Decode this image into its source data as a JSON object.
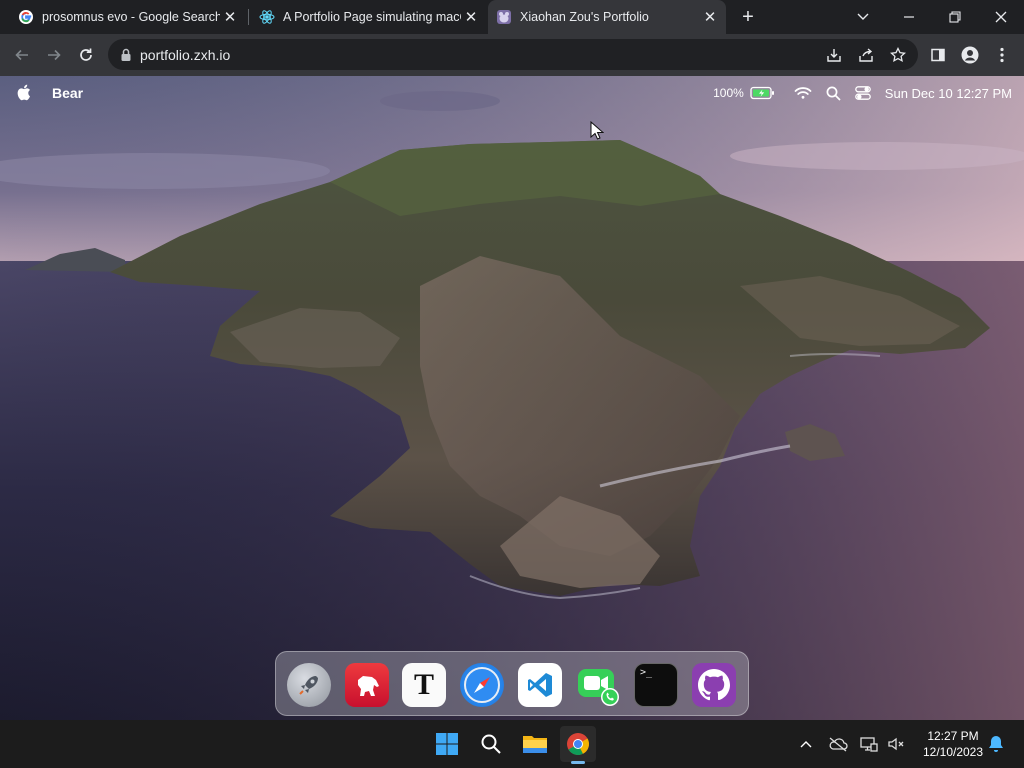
{
  "browser": {
    "tabs": [
      {
        "title": "prosomnus evo - Google Search",
        "icon": "google-icon"
      },
      {
        "title": "A Portfolio Page simulating macOS",
        "icon": "react-icon"
      },
      {
        "title": "Xiaohan Zou's Portfolio",
        "icon": "bear-icon",
        "active": true
      }
    ],
    "address": "portfolio.zxh.io"
  },
  "menubar": {
    "app_name": "Bear",
    "battery": "100%",
    "datetime": "Sun Dec 10 12:27 PM"
  },
  "dock": {
    "apps": [
      {
        "name": "Launchpad",
        "icon": "rocket-icon"
      },
      {
        "name": "Bear",
        "icon": "bear-app-icon"
      },
      {
        "name": "Typora",
        "icon": "typora-icon",
        "glyph": "T"
      },
      {
        "name": "Safari",
        "icon": "safari-icon"
      },
      {
        "name": "VSCode",
        "icon": "vscode-icon"
      },
      {
        "name": "FaceTime",
        "icon": "facetime-icon"
      },
      {
        "name": "Terminal",
        "icon": "terminal-icon",
        "glyph": ">_"
      },
      {
        "name": "GitHub",
        "icon": "github-icon"
      }
    ]
  },
  "taskbar": {
    "time": "12:27 PM",
    "date": "12/10/2023"
  }
}
